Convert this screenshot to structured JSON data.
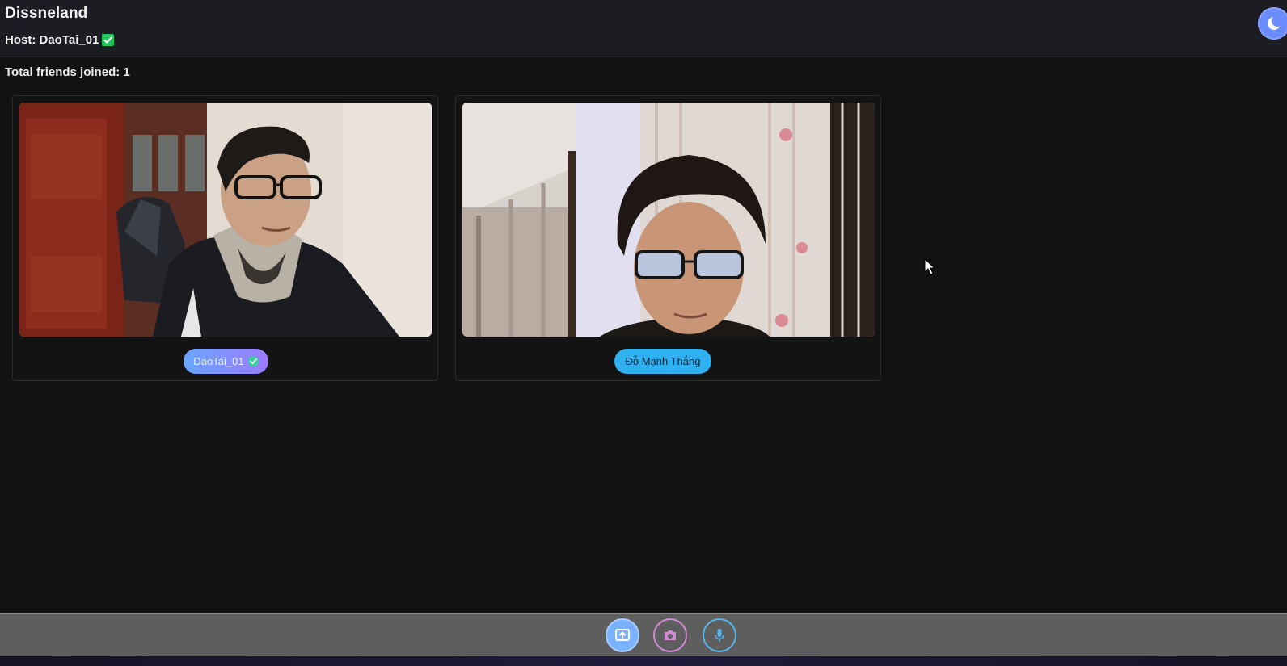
{
  "header": {
    "room_title": "Dissneland",
    "host_label": "Host: DaoTai_01",
    "host_verified_icon": "check-square-icon",
    "theme_toggle_icon": "moon-icon",
    "accent_color": "#6b8cff"
  },
  "main": {
    "friends_joined": "Total friends joined: 1",
    "participants": [
      {
        "name": "DaoTai_01",
        "verified": true,
        "video": "webcam-feed",
        "pill_color": "#7b9dff"
      },
      {
        "name": "Đỗ Mạnh Thắng",
        "verified": false,
        "video": "webcam-feed",
        "pill_color": "#2fb0f0"
      }
    ]
  },
  "controls": {
    "buttons": [
      {
        "name": "share-screen",
        "icon": "screen-share-icon",
        "color": "#7bb2ff"
      },
      {
        "name": "camera",
        "icon": "camera-icon",
        "color": "#d28ad6"
      },
      {
        "name": "microphone",
        "icon": "microphone-icon",
        "color": "#58b7e8"
      }
    ]
  }
}
